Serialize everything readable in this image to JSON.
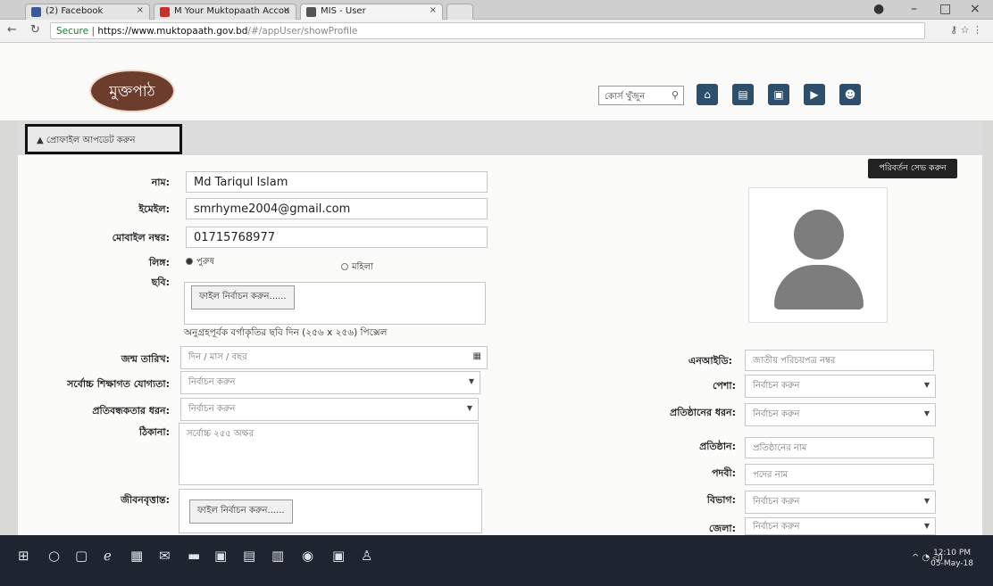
{
  "browser": {
    "tabs": [
      {
        "label": "(2) Facebook",
        "color": "#3b5998"
      },
      {
        "label": "M  Your Muktopaath Accou",
        "color": "#c9302c"
      },
      {
        "label": "MIS - User",
        "color": "#555555"
      }
    ],
    "url": {
      "secure": "Secure",
      "domain": "https://www.muktopaath.gov.bd",
      "path": "/#/appUser/showProfile"
    }
  },
  "header": {
    "logo_text": "মুক্তপাঠ",
    "search_label": "কোর্স খুঁজুন",
    "icons": [
      "home-icon",
      "book-icon",
      "notebook-icon",
      "play-icon",
      "user-icon"
    ],
    "icon_colors": [
      "#2d4f6c",
      "#2d4f6c",
      "#2d4f6c",
      "#2d4f6c",
      "#2d4f6c"
    ]
  },
  "profile": {
    "update_button": "প্রোফাইল আপডেট করুন",
    "save_button": "পরিবর্তন সেভ করুন"
  },
  "form_left": {
    "name_label": "নাম:",
    "name_value": "Md Tariqul Islam",
    "email_label": "ইমেইল:",
    "email_value": "smrhyme2004@gmail.com",
    "mobile_label": "মোবাইল নম্বর:",
    "mobile_value": "01715768977",
    "gender_label": "লিঙ্গ:",
    "gender_male": "পুরুষ",
    "gender_female": "মহিলা",
    "photo_label": "ছবি:",
    "photo_button": "ফাইল নির্বাচন করুন......",
    "photo_note": "অনুগ্রহপূর্বক বর্গাকৃতির ছবি দিন (২৫৬ x ২৫৬) পিক্সেল",
    "dob_label": "জন্ম তারিখ:",
    "dob_placeholder": "দিন / মাস / বছর",
    "edu_label": "সর্বোচ্চ শিক্ষাগত যোগ্যতা:",
    "edu_value": "নির্বাচন করুন",
    "disability_label": "প্রতিবন্ধকতার ধরন:",
    "disability_value": "নির্বাচন করুন",
    "address_label": "ঠিকানা:",
    "address_placeholder": "সর্বোচ্চ ২৫৫ অক্ষর",
    "cv_label": "জীবনবৃত্তান্ত:",
    "cv_button": "ফাইল নির্বাচন করুন......"
  },
  "form_right": {
    "nid_label": "এনআইডি:",
    "nid_placeholder": "জাতীয় পরিচয়পত্র নম্বর",
    "occupation_label": "পেশা:",
    "occupation_value": "নির্বাচন করুন",
    "org_type_label": "প্রতিষ্ঠানের ধরন:",
    "org_type_value": "নির্বাচন করুন",
    "org_label": "প্রতিষ্ঠান:",
    "org_placeholder": "প্রতিষ্ঠানের নাম",
    "designation_label": "পদবী:",
    "designation_placeholder": "পদের নাম",
    "division_label": "বিভাগ:",
    "division_value": "নির্বাচন করুন",
    "district_label": "জেলা:",
    "district_value": "নির্বাচন করুন"
  },
  "taskbar": {
    "time": "12:10 PM",
    "date": "05-May-18"
  }
}
